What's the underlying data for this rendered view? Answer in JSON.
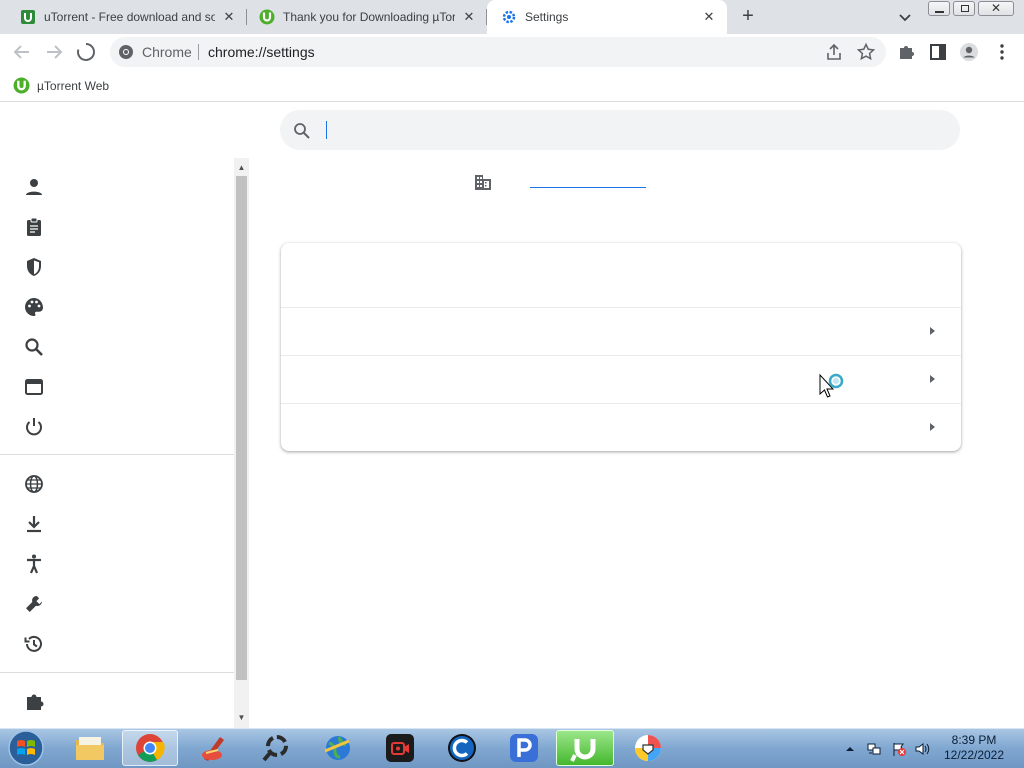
{
  "tabs": [
    {
      "title": "uTorrent - Free download and software",
      "favicon": "green-square-icon"
    },
    {
      "title": "Thank you for Downloading µTorrent",
      "favicon": "utorrent-icon"
    },
    {
      "title": "Settings",
      "favicon": "settings-gear-icon",
      "active": true
    }
  ],
  "toolbar": {
    "chip_label": "Chrome",
    "url": "chrome://settings"
  },
  "bookmarks": [
    {
      "label": "µTorrent Web",
      "icon": "utorrent-icon"
    }
  ],
  "settings": {
    "search_value": "",
    "sidebar_icons": [
      "person-icon",
      "clipboard-icon",
      "shield-icon",
      "palette-icon",
      "search-icon",
      "browser-window-icon",
      "power-icon",
      "globe-icon",
      "download-icon",
      "accessibility-icon",
      "wrench-icon",
      "history-icon",
      "extension-icon"
    ]
  },
  "taskbar": {
    "apps": [
      "explorer",
      "chrome",
      "ccleaner",
      "app-search",
      "browser-globe",
      "screen-recorder",
      "ccleaner-c",
      "p-app",
      "utorrent",
      "generic-app"
    ],
    "time": "8:39 PM",
    "date": "12/22/2022"
  },
  "colors": {
    "tabstrip": "#dee1e6",
    "accent": "#1a73e8",
    "utorrent_green": "#4caf2a"
  }
}
